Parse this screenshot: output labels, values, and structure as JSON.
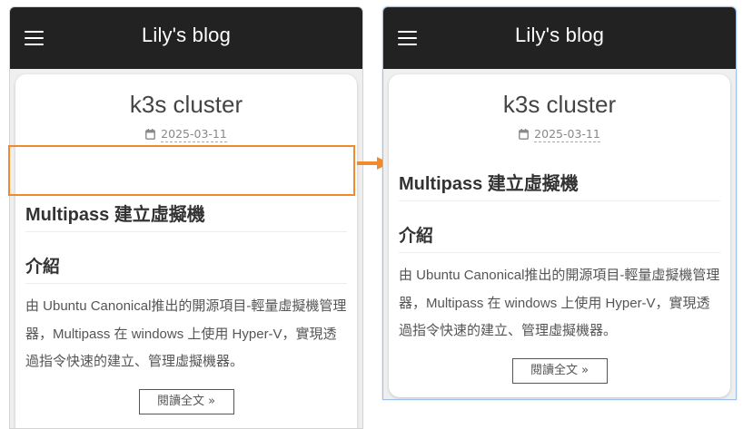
{
  "header": {
    "menu_icon": "hamburger-icon",
    "title": "Lily's blog"
  },
  "post": {
    "title": "k3s cluster",
    "date_icon": "calendar-icon",
    "date": "2025-03-11",
    "heading": "Multipass 建立虛擬機",
    "subheading": "介紹",
    "paragraph": "由 Ubuntu Canonical推出的開源項目-輕量虛擬機管理器，Multipass 在 windows 上使用 Hyper-V，實現透過指令快速的建立、管理虛擬機器。",
    "read_more": "閱讀全文 »"
  },
  "colors": {
    "header_bg": "#222222",
    "page_bg": "#efefef",
    "highlight": "#f08a2c",
    "focus_border": "#9cc0ea"
  }
}
